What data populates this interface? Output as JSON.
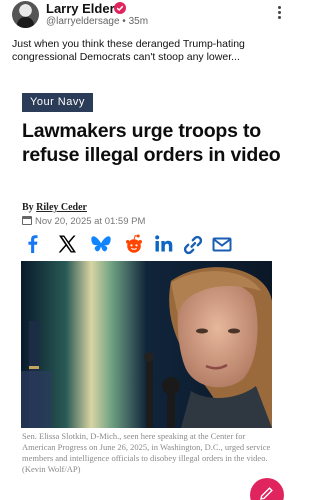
{
  "post": {
    "author_name": "Larry Elder",
    "handle": "@larryeldersage",
    "separator": "•",
    "time_ago": "35m",
    "text": "Just when you think these deranged Trump-hating congressional Democrats can't stoop any lower..."
  },
  "article": {
    "section": "Your Navy",
    "headline": "Lawmakers urge troops to refuse illegal orders in video",
    "by_prefix": "By",
    "author": "Riley Ceder",
    "date": "Nov 20, 2025 at 01:59 PM",
    "share_icons": [
      "facebook-icon",
      "x-icon",
      "bluesky-icon",
      "reddit-icon",
      "linkedin-icon",
      "link-icon",
      "email-icon"
    ],
    "share_colors": {
      "facebook": "#1877f2",
      "x": "#000000",
      "bluesky": "#1185fe",
      "reddit": "#ff4500",
      "linkedin": "#0a66c2",
      "link": "#1a5fb4",
      "email": "#1a5fb4"
    },
    "caption": "Sen. Elissa Slotkin, D-Mich., seen here speaking at the Center for American Progress on June 26, 2025, in Washington, D.C., urged service members and intelligence officials to disobey illegal orders in the video. (Kevin Wolf/AP)"
  },
  "colors": {
    "accent": "#e0245e",
    "section_tag_bg": "#2a3c57"
  }
}
